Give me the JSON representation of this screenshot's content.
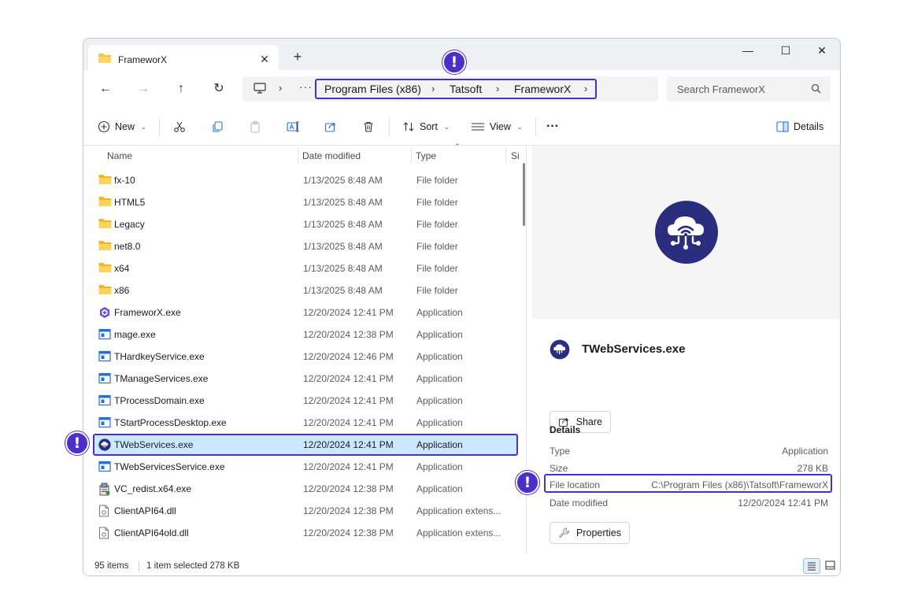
{
  "window": {
    "tab_title": "FrameworX",
    "new_tab": "+",
    "minimize": "—",
    "maximize": "☐",
    "close": "✕"
  },
  "nav": {
    "back": "←",
    "forward": "→",
    "up": "↑",
    "refresh": "↻",
    "overflow": "···",
    "breadcrumb": [
      "Program Files (x86)",
      "Tatsoft",
      "FrameworX"
    ],
    "chevron": "›"
  },
  "search": {
    "placeholder": "Search FrameworX"
  },
  "toolbar": {
    "new_label": "New",
    "sort_label": "Sort",
    "view_label": "View",
    "more": "···",
    "details_label": "Details",
    "caret": "⌄"
  },
  "columns": {
    "name": "Name",
    "date": "Date modified",
    "type": "Type",
    "size": "Si",
    "sort_arrow": "⌃"
  },
  "files": [
    {
      "name": "fx-10",
      "date": "1/13/2025 8:48 AM",
      "type": "File folder",
      "icon": "folder-icon"
    },
    {
      "name": "HTML5",
      "date": "1/13/2025 8:48 AM",
      "type": "File folder",
      "icon": "folder-icon"
    },
    {
      "name": "Legacy",
      "date": "1/13/2025 8:48 AM",
      "type": "File folder",
      "icon": "folder-icon"
    },
    {
      "name": "net8.0",
      "date": "1/13/2025 8:48 AM",
      "type": "File folder",
      "icon": "folder-icon"
    },
    {
      "name": "x64",
      "date": "1/13/2025 8:48 AM",
      "type": "File folder",
      "icon": "folder-icon"
    },
    {
      "name": "x86",
      "date": "1/13/2025 8:48 AM",
      "type": "File folder",
      "icon": "folder-icon"
    },
    {
      "name": "FrameworX.exe",
      "date": "12/20/2024 12:41 PM",
      "type": "Application",
      "icon": "frameworx-app-icon"
    },
    {
      "name": "mage.exe",
      "date": "12/20/2024 12:38 PM",
      "type": "Application",
      "icon": "app-window-icon"
    },
    {
      "name": "THardkeyService.exe",
      "date": "12/20/2024 12:46 PM",
      "type": "Application",
      "icon": "app-window-icon"
    },
    {
      "name": "TManageServices.exe",
      "date": "12/20/2024 12:41 PM",
      "type": "Application",
      "icon": "app-window-icon"
    },
    {
      "name": "TProcessDomain.exe",
      "date": "12/20/2024 12:41 PM",
      "type": "Application",
      "icon": "app-window-icon"
    },
    {
      "name": "TStartProcessDesktop.exe",
      "date": "12/20/2024 12:41 PM",
      "type": "Application",
      "icon": "app-window-icon"
    },
    {
      "name": "TWebServices.exe",
      "date": "12/20/2024 12:41 PM",
      "type": "Application",
      "icon": "cloud-service-icon",
      "selected": true
    },
    {
      "name": "TWebServicesService.exe",
      "date": "12/20/2024 12:41 PM",
      "type": "Application",
      "icon": "app-window-icon"
    },
    {
      "name": "VC_redist.x64.exe",
      "date": "12/20/2024 12:38 PM",
      "type": "Application",
      "icon": "installer-icon"
    },
    {
      "name": "ClientAPI64.dll",
      "date": "12/20/2024 12:38 PM",
      "type": "Application extens...",
      "icon": "dll-file-icon"
    },
    {
      "name": "ClientAPI64old.dll",
      "date": "12/20/2024 12:38 PM",
      "type": "Application extens...",
      "icon": "dll-file-icon"
    }
  ],
  "details_pane": {
    "title": "TWebServices.exe",
    "share_label": "Share",
    "section": "Details",
    "type_key": "Type",
    "type_value": "Application",
    "size_key": "Size",
    "size_value": "278 KB",
    "location_key": "File location",
    "location_value": "C:\\Program Files (x86)\\Tatsoft\\FrameworX",
    "modified_key": "Date modified",
    "modified_value": "12/20/2024 12:41 PM",
    "properties_label": "Properties"
  },
  "status": {
    "items": "95 items",
    "selected": "1 item selected  278 KB"
  },
  "callout": {
    "mark": "!"
  },
  "colors": {
    "accent": "#4b2fc9",
    "selection": "#cce8ff",
    "app_icon": "#2b2d7e",
    "folder": "#f6c344"
  }
}
